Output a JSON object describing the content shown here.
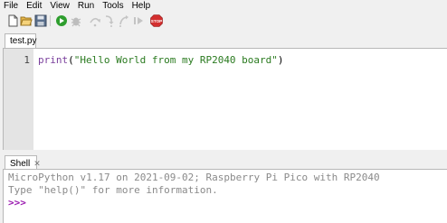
{
  "menu": [
    "File",
    "Edit",
    "View",
    "Run",
    "Tools",
    "Help"
  ],
  "toolbar": {
    "buttons": [
      "new-file",
      "open-file",
      "save-file",
      "run",
      "debug",
      "step-over",
      "step-into",
      "step-out",
      "resume",
      "stop"
    ],
    "stop_label": "STOP",
    "colors": {
      "run": "#2e9e2e",
      "stop": "#d32f2f"
    }
  },
  "editor": {
    "tab_label": "test.py",
    "line_number": "1",
    "code": {
      "func": "print",
      "open": "(",
      "string": "\"Hello World from my RP2040 board\"",
      "close": ")"
    }
  },
  "shell": {
    "tab_label": "Shell",
    "close_glyph": "✕",
    "banner": "MicroPython v1.17 on 2021-09-02; Raspberry Pi Pico with RP2040",
    "help_line": "Type \"help()\" for more information.",
    "prompt": ">>>"
  }
}
